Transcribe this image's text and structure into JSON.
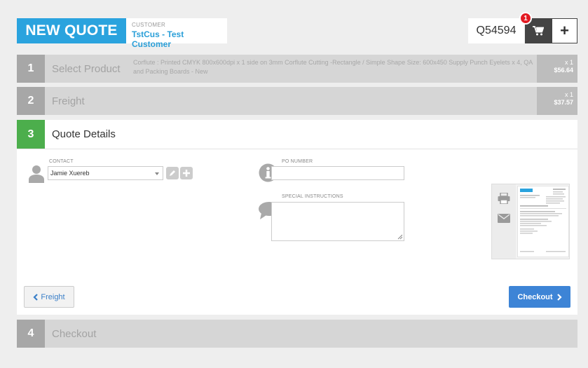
{
  "header": {
    "title": "NEW QUOTE",
    "customer_label": "CUSTOMER",
    "customer_value": "TstCus - Test Customer",
    "quote_number": "Q54594",
    "cart_count": "1",
    "add_label": "+"
  },
  "steps": [
    {
      "num": "1",
      "name": "Select Product",
      "description": "Corflute : Printed CMYK 800x600dpi x 1 side on 3mm Corflute Cutting -Rectangle / Simple Shape Size: 600x450 Supply Punch Eyelets x 4, QA and Packing Boards - New",
      "qty": "x 1",
      "price": "$56.64"
    },
    {
      "num": "2",
      "name": "Freight",
      "qty": "x 1",
      "price": "$37.57"
    },
    {
      "num": "3",
      "name": "Quote Details"
    },
    {
      "num": "4",
      "name": "Checkout"
    }
  ],
  "details": {
    "contact_label": "CONTACT",
    "contact_value": "Jamie Xuereb",
    "po_label": "PO NUMBER",
    "po_value": "",
    "instructions_label": "SPECIAL INSTRUCTIONS",
    "instructions_value": ""
  },
  "buttons": {
    "back_label": "Freight",
    "next_label": "Checkout"
  },
  "colors": {
    "brand_blue": "#2aa3de",
    "active_step": "#4cae4c",
    "checkout_button": "#3d84d6",
    "badge_red": "#e31b23"
  }
}
